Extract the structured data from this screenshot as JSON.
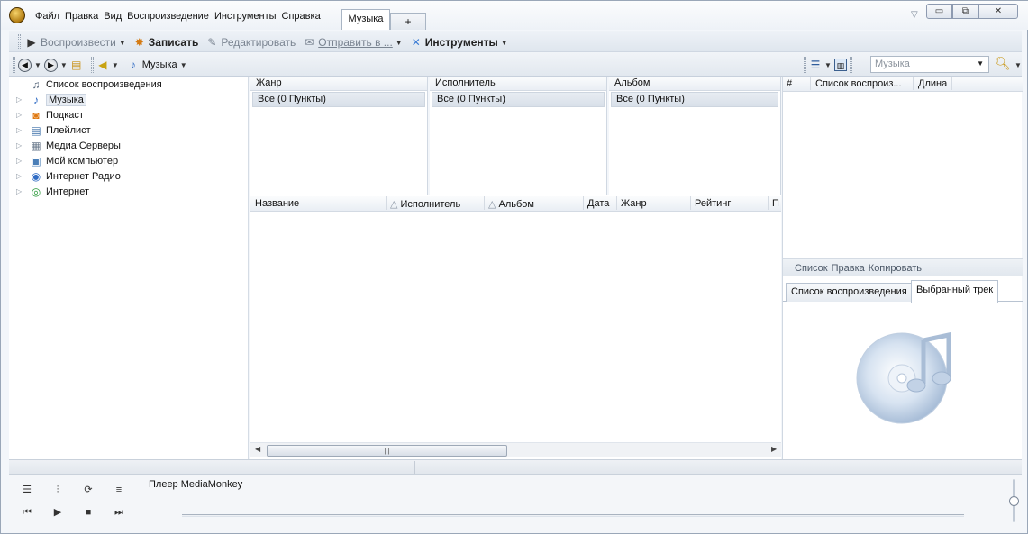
{
  "menu": [
    "Файл",
    "Правка",
    "Вид",
    "Воспроизведение",
    "Инструменты",
    "Справка"
  ],
  "tabs": {
    "active": "Музыка",
    "add": "+"
  },
  "window_buttons": {
    "minimize": "▭",
    "restore": "⧉",
    "close": "✕"
  },
  "toolbar": {
    "play": "Воспроизвести",
    "burn": "Записать",
    "edit": "Редактировать",
    "send": "Отправить в ...",
    "tools": "Инструменты"
  },
  "nav": {
    "location": "Музыка"
  },
  "search": {
    "value": "Музыка"
  },
  "tree": [
    {
      "label": "Список воспроизведения",
      "icon": "playlist-icon"
    },
    {
      "label": "Музыка",
      "icon": "music-note-icon"
    },
    {
      "label": "Подкаст",
      "icon": "podcast-icon"
    },
    {
      "label": "Плейлист",
      "icon": "playlist-file-icon"
    },
    {
      "label": "Медиа Серверы",
      "icon": "media-server-icon"
    },
    {
      "label": "Мой компьютер",
      "icon": "computer-icon"
    },
    {
      "label": "Интернет Радио",
      "icon": "radio-icon"
    },
    {
      "label": "Интернет",
      "icon": "globe-icon"
    }
  ],
  "filters": [
    {
      "header": "Жанр",
      "all": "Все (0 Пункты)"
    },
    {
      "header": "Исполнитель",
      "all": "Все (0 Пункты)"
    },
    {
      "header": "Альбом",
      "all": "Все (0 Пункты)"
    }
  ],
  "tracklist": {
    "columns": [
      "Название",
      "Исполнитель",
      "Альбом",
      "Дата",
      "Жанр",
      "Рейтинг",
      "П"
    ]
  },
  "right_panel": {
    "columns": [
      "#",
      "Список воспроиз...",
      "Длина"
    ],
    "toolbar": [
      "Список",
      "Правка",
      "Копировать"
    ],
    "tabs": [
      "Список воспроизведения",
      "Выбранный трек"
    ]
  },
  "player": {
    "title": "Плеер MediaMonkey"
  }
}
